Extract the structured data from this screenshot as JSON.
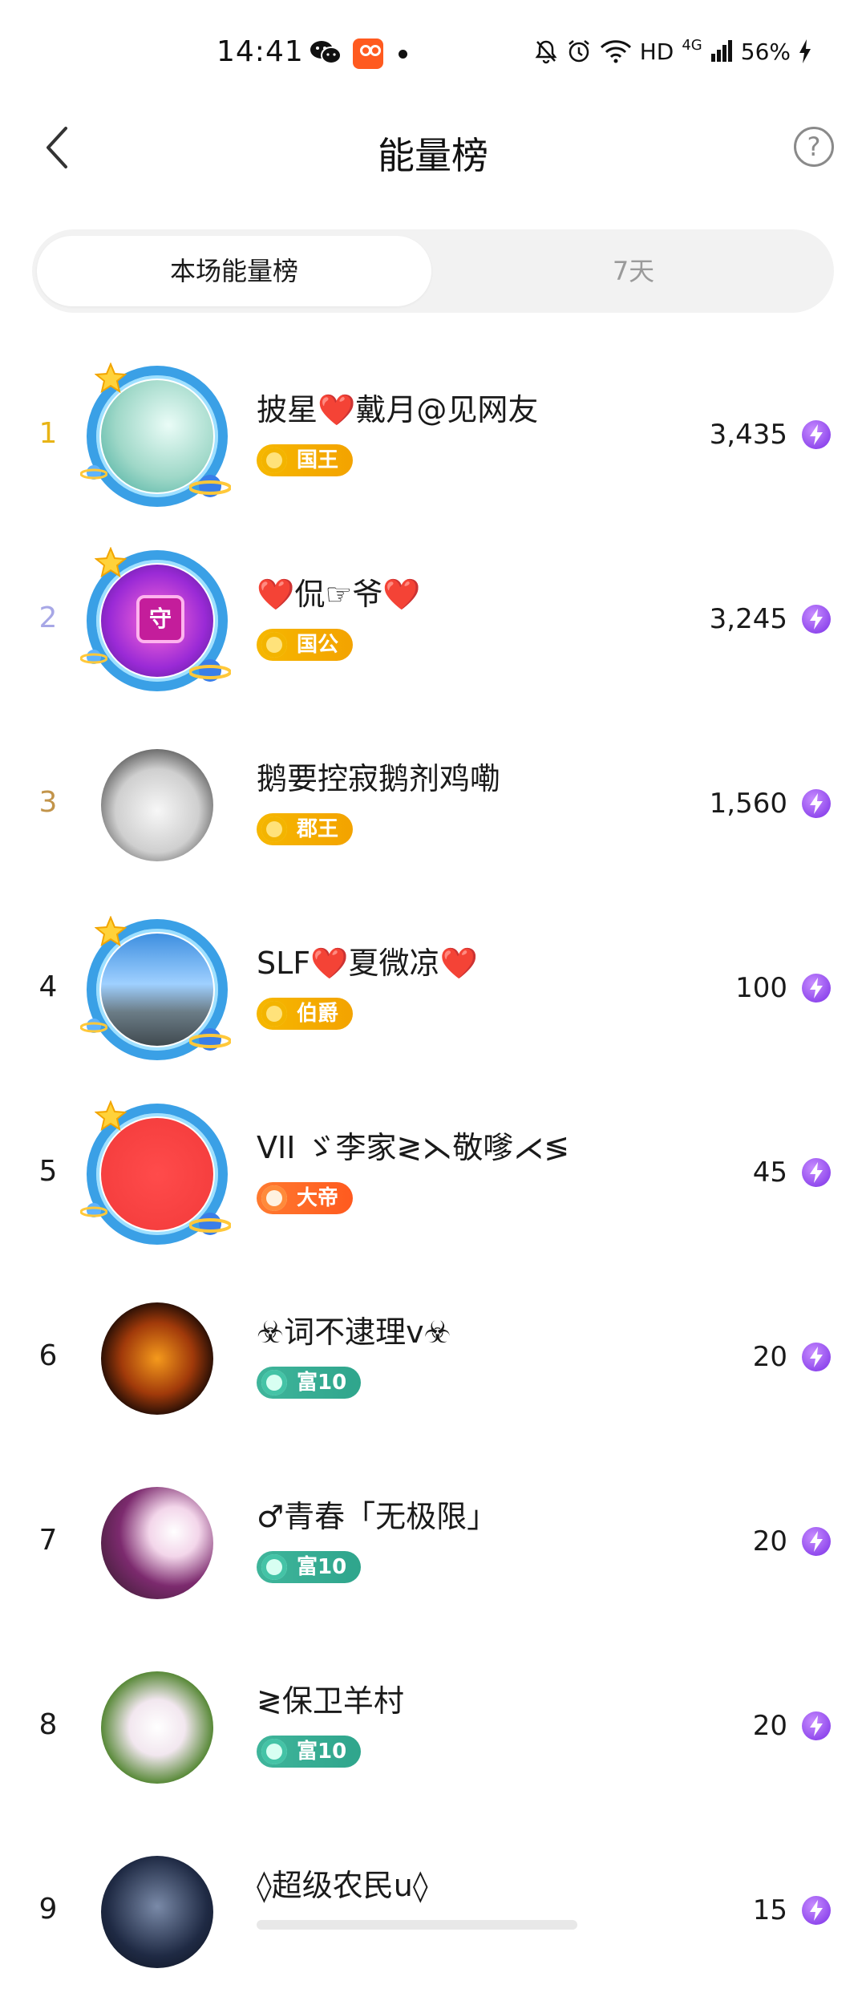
{
  "status_bar": {
    "time": "14:41",
    "network": "HD",
    "signal": "4G",
    "battery": "56%"
  },
  "header": {
    "title": "能量榜"
  },
  "tabs": [
    {
      "label": "本场能量榜",
      "active": true
    },
    {
      "label": "7天",
      "active": false
    }
  ],
  "ranking": [
    {
      "rank": "1",
      "name": "披星❤️戴月@见网友",
      "badge": "国王",
      "badge_style": "gold",
      "score": "3,435",
      "rank_color": "#e8b416",
      "avatar_frame": true
    },
    {
      "rank": "2",
      "name": "❤️侃☞爷❤️",
      "badge": "国公",
      "badge_style": "gold",
      "score": "3,245",
      "rank_color": "#a7a7e6",
      "avatar_frame": true
    },
    {
      "rank": "3",
      "name": "鹅要控寂鹅剂鸡嘞",
      "badge": "郡王",
      "badge_style": "gold",
      "score": "1,560",
      "rank_color": "#c2944a",
      "avatar_frame": false
    },
    {
      "rank": "4",
      "name": "SLF❤️夏微凉❤️",
      "badge": "伯爵",
      "badge_style": "gold",
      "score": "100",
      "rank_color": "#1a1a1a",
      "avatar_frame": true
    },
    {
      "rank": "5",
      "name": "VII ゞ李家≷⋋敬嗲⋌≶",
      "badge": "大帝",
      "badge_style": "orange",
      "score": "45",
      "rank_color": "#1a1a1a",
      "avatar_frame": true
    },
    {
      "rank": "6",
      "name": "☣词不逮理v☣",
      "badge": "富10",
      "badge_style": "green",
      "score": "20",
      "rank_color": "#1a1a1a",
      "avatar_frame": false
    },
    {
      "rank": "7",
      "name": "♂青春「无极限」",
      "badge": "富10",
      "badge_style": "green",
      "score": "20",
      "rank_color": "#1a1a1a",
      "avatar_frame": false
    },
    {
      "rank": "8",
      "name": "≷保卫羊村",
      "badge": "富10",
      "badge_style": "green",
      "score": "20",
      "rank_color": "#1a1a1a",
      "avatar_frame": false
    },
    {
      "rank": "9",
      "name": "◊超级农民u◊",
      "badge": "",
      "badge_style": "green",
      "score": "15",
      "rank_color": "#1a1a1a",
      "avatar_frame": false
    }
  ],
  "colors": {
    "accent_gold": "#f3a300",
    "accent_orange": "#ff5a1f",
    "accent_green": "#2fa58c",
    "energy_purple": "#7a2fe6"
  }
}
